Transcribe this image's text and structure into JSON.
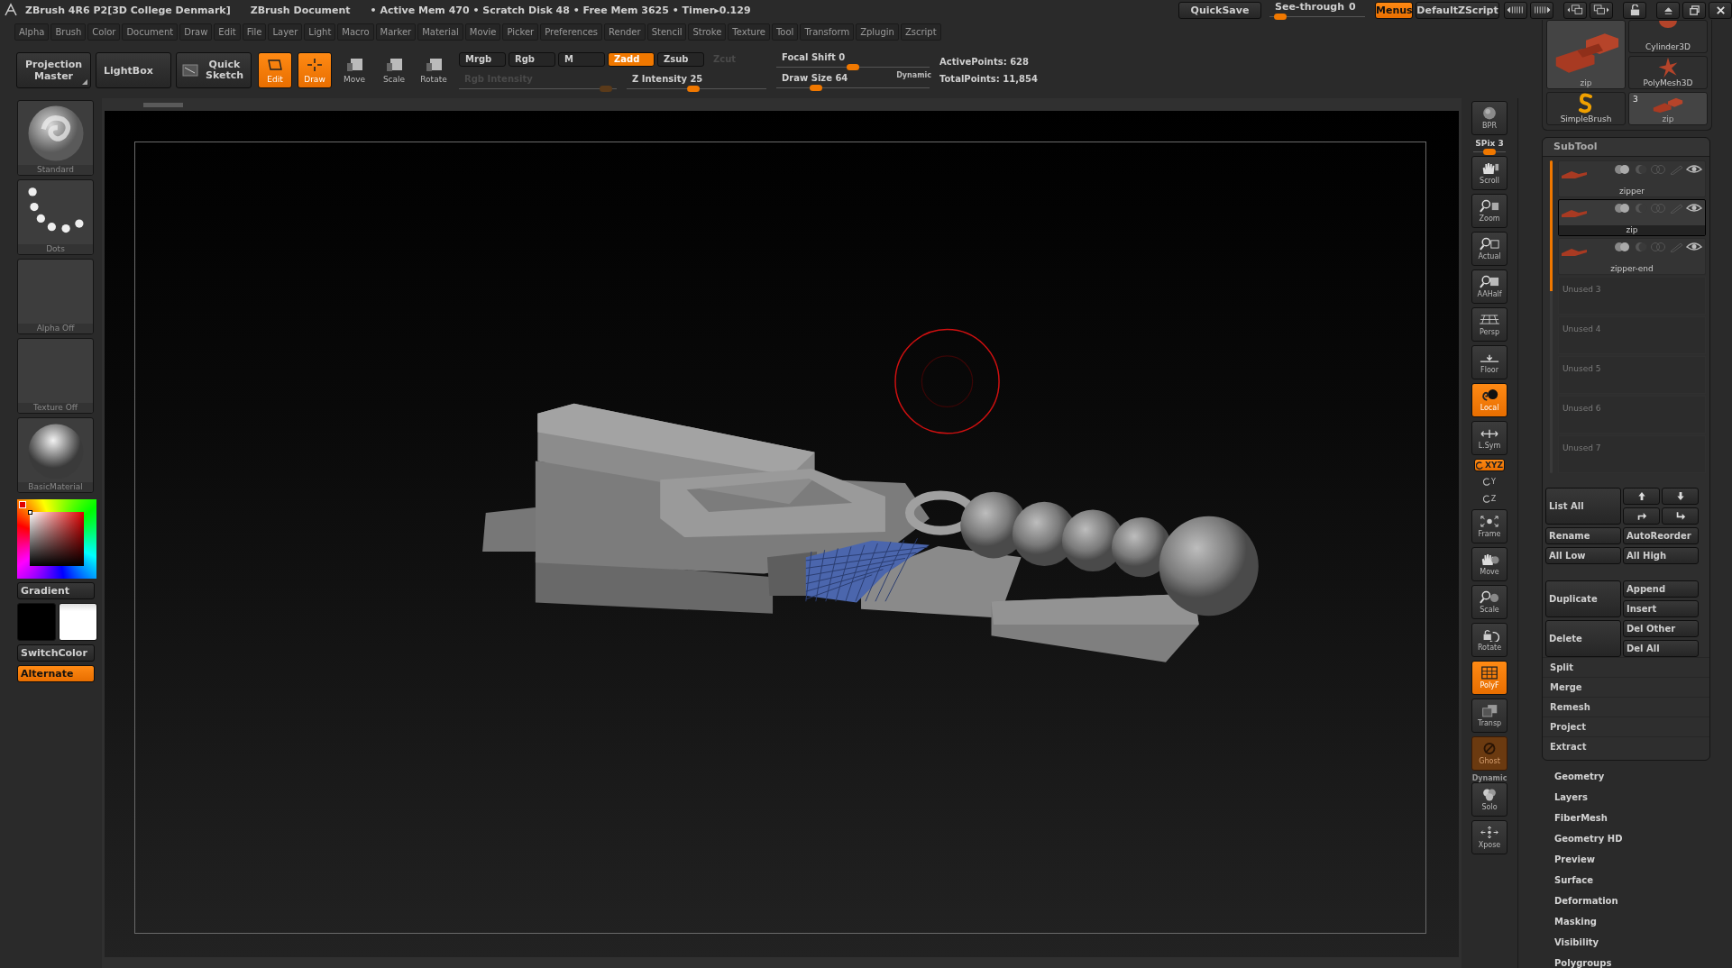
{
  "title_bar": {
    "app_title": "ZBrush 4R6 P2[3D College Denmark]",
    "document_title": "ZBrush Document",
    "stats": "• Active Mem 470 • Scratch Disk 48 • Free Mem 3625 • Timer▸0.129"
  },
  "top_right": {
    "quicksave": "QuickSave",
    "see_through": {
      "label": "See-through",
      "value": "0",
      "level": 0.05
    },
    "menus": {
      "label": "Menus",
      "on": true
    },
    "script": "DefaultZScript"
  },
  "menu_bar": [
    "Alpha",
    "Brush",
    "Color",
    "Document",
    "Draw",
    "Edit",
    "File",
    "Layer",
    "Light",
    "Macro",
    "Marker",
    "Material",
    "Movie",
    "Picker",
    "Preferences",
    "Render",
    "Stencil",
    "Stroke",
    "Texture",
    "Tool",
    "Transform",
    "Zplugin",
    "Zscript"
  ],
  "shelf": {
    "projection_master": "Projection Master",
    "lightbox": "LightBox",
    "quick_sketch": "Quick Sketch",
    "modes": [
      {
        "label": "Edit",
        "on": true
      },
      {
        "label": "Draw",
        "on": true
      },
      {
        "label": "Move",
        "on": false
      },
      {
        "label": "Scale",
        "on": false
      },
      {
        "label": "Rotate",
        "on": false
      }
    ],
    "channels": [
      {
        "label": "Mrgb",
        "selected": false,
        "disabled": false
      },
      {
        "label": "Rgb",
        "selected": false,
        "disabled": false
      },
      {
        "label": "M",
        "selected": false,
        "disabled": false
      },
      {
        "label": "Zadd",
        "selected": true,
        "disabled": false
      },
      {
        "label": "Zsub",
        "selected": false,
        "disabled": false
      },
      {
        "label": "Zcut",
        "selected": false,
        "disabled": true
      }
    ],
    "rgb_intensity": {
      "label": "Rgb Intensity",
      "disabled": true,
      "level": 0.93
    },
    "z_intensity": {
      "label": "Z Intensity",
      "value": "25",
      "disabled": false,
      "level": 0.48
    },
    "focal_shift": {
      "label": "Focal Shift",
      "value": "0",
      "level": 0.5
    },
    "draw_size": {
      "label": "Draw Size",
      "value": "64",
      "level": 0.26
    },
    "dynamic": "Dynamic",
    "active_points": "ActivePoints: 628",
    "total_points": "TotalPoints: 11,854"
  },
  "left_panel": {
    "thumbnails": [
      {
        "label": "Standard",
        "kind": "brush"
      },
      {
        "label": "Dots",
        "kind": "stroke"
      },
      {
        "label": "Alpha Off",
        "kind": "empty"
      },
      {
        "label": "Texture Off",
        "kind": "empty"
      },
      {
        "label": "BasicMaterial",
        "kind": "material"
      }
    ],
    "gradient": "Gradient",
    "switch_color": "SwitchColor",
    "alternate": {
      "label": "Alternate",
      "on": true
    }
  },
  "right_toolbar": [
    {
      "kind": "button",
      "label": "BPR",
      "on": false,
      "disabled": false
    },
    {
      "kind": "slider",
      "label": "SPix 3",
      "level": 0.5
    },
    {
      "kind": "button",
      "label": "Scroll",
      "on": false,
      "disabled": false
    },
    {
      "kind": "button",
      "label": "Zoom",
      "on": false,
      "disabled": false
    },
    {
      "kind": "button",
      "label": "Actual",
      "on": false,
      "disabled": false
    },
    {
      "kind": "button",
      "label": "AAHalf",
      "on": false,
      "disabled": false
    },
    {
      "kind": "button",
      "label": "Persp",
      "on": false,
      "disabled": false
    },
    {
      "kind": "button",
      "label": "Floor",
      "on": false,
      "disabled": false
    },
    {
      "kind": "button",
      "label": "Local",
      "on": true,
      "disabled": false
    },
    {
      "kind": "button",
      "label": "L.Sym",
      "on": false,
      "disabled": false
    },
    {
      "kind": "pill",
      "label": "XYZ",
      "on": true,
      "disabled": false
    },
    {
      "kind": "mini",
      "label": "Y"
    },
    {
      "kind": "mini",
      "label": "Z"
    },
    {
      "kind": "button",
      "label": "Frame",
      "on": false,
      "disabled": false
    },
    {
      "kind": "button",
      "label": "Move",
      "on": false,
      "disabled": false
    },
    {
      "kind": "button",
      "label": "Scale",
      "on": false,
      "disabled": false
    },
    {
      "kind": "button",
      "label": "Rotate",
      "on": false,
      "disabled": false
    },
    {
      "kind": "button",
      "label": "PolyF",
      "on": true,
      "disabled": false
    },
    {
      "kind": "button",
      "label": "Transp",
      "on": false,
      "disabled": false
    },
    {
      "kind": "button",
      "label": "Ghost",
      "on": false,
      "disabled": true
    },
    {
      "kind": "caption",
      "label": "Dynamic"
    },
    {
      "kind": "button",
      "label": "Solo",
      "on": false,
      "disabled": false
    },
    {
      "kind": "button",
      "label": "Xpose",
      "on": false,
      "disabled": false
    }
  ],
  "tool_palette": [
    {
      "label": "zip",
      "kind": "large"
    },
    {
      "label": "Cylinder3D",
      "kind": "cylinder"
    },
    {
      "label": "PolyMesh3D",
      "kind": "star"
    },
    {
      "label": "SimpleBrush",
      "kind": "brush"
    },
    {
      "label": "zip",
      "kind": "model",
      "count": "3"
    }
  ],
  "subtool": {
    "title": "SubTool",
    "items": [
      {
        "name": "zipper",
        "selected": false
      },
      {
        "name": "zip",
        "selected": true
      },
      {
        "name": "zipper-end",
        "selected": false
      }
    ],
    "unused": [
      "Unused 3",
      "Unused 4",
      "Unused 5",
      "Unused 6",
      "Unused 7"
    ],
    "list_all": "List All",
    "rename": "Rename",
    "auto_reorder": "AutoReorder",
    "all_low": "All Low",
    "all_high": "All High",
    "duplicate": "Duplicate",
    "append": "Append",
    "insert": "Insert",
    "delete": "Delete",
    "del_other": "Del Other",
    "del_all": "Del All",
    "actions": [
      "Split",
      "Merge",
      "Remesh",
      "Project",
      "Extract"
    ]
  },
  "tool_menu": [
    "Geometry",
    "Layers",
    "FiberMesh",
    "Geometry HD",
    "Preview",
    "Surface",
    "Deformation",
    "Masking",
    "Visibility",
    "Polygroups"
  ]
}
